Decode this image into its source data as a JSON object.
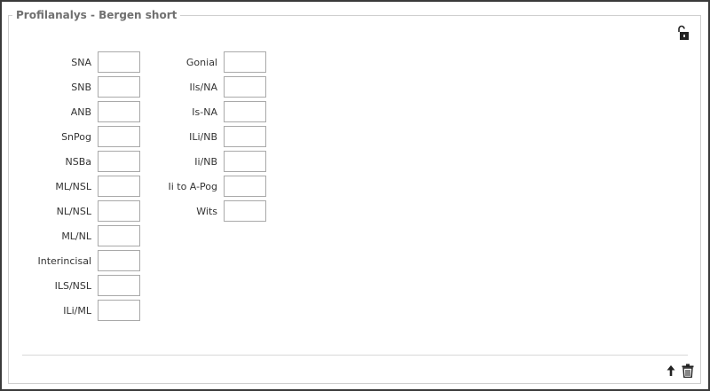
{
  "panel": {
    "title": "Profilanalys - Bergen short"
  },
  "left_column": [
    {
      "label": "SNA",
      "value": ""
    },
    {
      "label": "SNB",
      "value": ""
    },
    {
      "label": "ANB",
      "value": ""
    },
    {
      "label": "SnPog",
      "value": ""
    },
    {
      "label": "NSBa",
      "value": ""
    },
    {
      "label": "ML/NSL",
      "value": ""
    },
    {
      "label": "NL/NSL",
      "value": ""
    },
    {
      "label": "ML/NL",
      "value": ""
    },
    {
      "label": "Interincisal",
      "value": ""
    },
    {
      "label": "ILS/NSL",
      "value": ""
    },
    {
      "label": "ILi/ML",
      "value": ""
    }
  ],
  "right_column": [
    {
      "label": "Gonial",
      "value": ""
    },
    {
      "label": "Ils/NA",
      "value": ""
    },
    {
      "label": "Is-NA",
      "value": ""
    },
    {
      "label": "ILi/NB",
      "value": ""
    },
    {
      "label": "Ii/NB",
      "value": ""
    },
    {
      "label": "Ii to A-Pog",
      "value": ""
    },
    {
      "label": "Wits",
      "value": ""
    }
  ],
  "icons": {
    "lock": "unlock-icon",
    "move_up": "arrow-up-icon",
    "delete": "trash-icon"
  },
  "colors": {
    "frame": "#3a3a3a",
    "group_border": "#cfcfcf",
    "title": "#707070",
    "field_border": "#a9a9a9"
  }
}
